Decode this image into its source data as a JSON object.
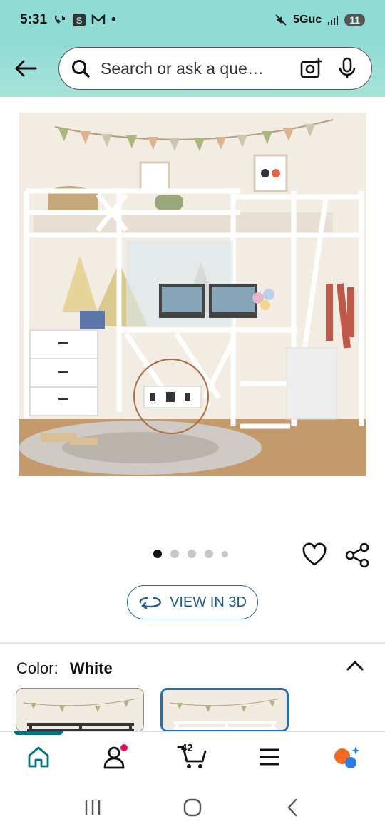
{
  "status_bar": {
    "time": "5:31",
    "network": "5Guc",
    "battery": "11"
  },
  "search": {
    "placeholder": "Search or ask a question",
    "display_text": "Search or ask a que…"
  },
  "gallery": {
    "dot_count": 5,
    "active_index": 0
  },
  "view3d": {
    "label": "VIEW IN 3D"
  },
  "color": {
    "label": "Color:",
    "value": "White"
  },
  "nav": {
    "cart_count": "42"
  },
  "colors": {
    "header_bg": "#8fdbd5",
    "accent": "#007185",
    "link": "#2270b6"
  }
}
